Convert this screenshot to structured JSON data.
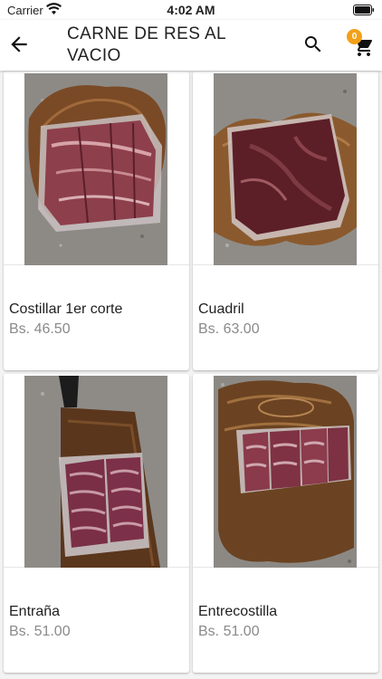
{
  "status": {
    "carrier": "Carrier",
    "time": "4:02 AM"
  },
  "header": {
    "title": "CARNE DE RES AL VACIO",
    "cart_count": "0",
    "accent_color": "#f2a017"
  },
  "products": [
    {
      "name": "Costillar 1er corte",
      "price": "Bs. 46.50",
      "image": "vacuum-packed-ribs-on-wood-board"
    },
    {
      "name": "Cuadril",
      "price": "Bs. 63.00",
      "image": "vacuum-packed-rump-on-wood-board"
    },
    {
      "name": "Entraña",
      "price": "Bs. 51.00",
      "image": "vacuum-packed-skirt-steak-on-knife-board"
    },
    {
      "name": "Entrecostilla",
      "price": "Bs. 51.00",
      "image": "vacuum-packed-rib-meat-on-wood-slab"
    }
  ]
}
